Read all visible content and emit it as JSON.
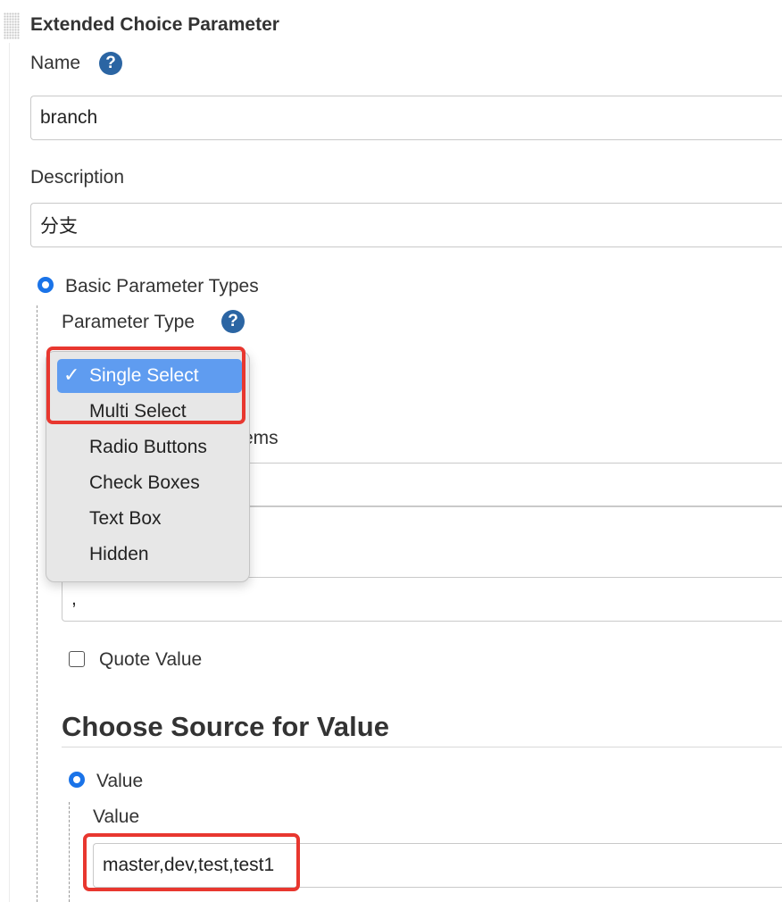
{
  "section": {
    "title": "Extended Choice Parameter"
  },
  "name_field": {
    "label": "Name",
    "value": "branch",
    "help_icon": "question-icon"
  },
  "description_field": {
    "label": "Description",
    "value": "分支"
  },
  "basic_param": {
    "radio_label": "Basic Parameter Types",
    "selected": true
  },
  "parameter_type": {
    "label": "Parameter Type",
    "options": [
      "Single Select",
      "Multi Select",
      "Radio Buttons",
      "Check Boxes",
      "Text Box",
      "Hidden"
    ],
    "selected": "Single Select",
    "checkmark": "✓"
  },
  "partial_label": "ems",
  "delimiter_value": ",",
  "quote_value": {
    "label": "Quote Value",
    "checked": false
  },
  "choose_source": {
    "heading": "Choose Source for Value"
  },
  "value_radio": {
    "label": "Value",
    "selected": true
  },
  "value_field": {
    "label": "Value",
    "value": "master,dev,test,test1"
  },
  "colors": {
    "accent": "#1a73e8",
    "help": "#2b65a3",
    "highlight": "#e8372f",
    "selection": "#5f9cf0"
  }
}
